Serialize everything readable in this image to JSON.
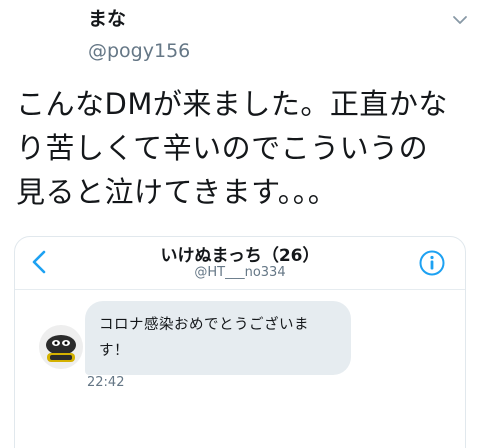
{
  "tweet": {
    "display_name": "まな",
    "handle": "@pogy156",
    "text_lines": [
      "こんなDMが来ました。正直かな",
      "り苦しくて辛いのでこういうの",
      "見ると泣けてきます。。。"
    ],
    "menu_icon": "chevron-down-icon"
  },
  "dm": {
    "title": "いけぬまっち（26）",
    "handle": "@HT___no334",
    "back_icon": "chevron-left-icon",
    "info_icon": "info-icon",
    "message": {
      "text": "コロナ感染おめでとうございます！",
      "time": "22:42"
    }
  },
  "colors": {
    "accent": "#1da1f2",
    "secondary_text": "#657786",
    "bubble": "#e6ecf0"
  }
}
